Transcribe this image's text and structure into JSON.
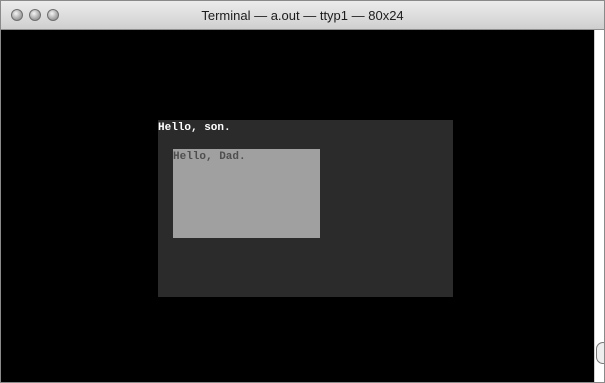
{
  "window": {
    "title": "Terminal — a.out — ttyp1 — 80x24"
  },
  "terminal": {
    "outer_window": {
      "text": "Hello, son."
    },
    "inner_window": {
      "text": "Hello, Dad."
    }
  },
  "colors": {
    "terminal_bg": "#000000",
    "outer_window_bg": "#2b2b2b",
    "inner_window_bg": "#a0a0a0",
    "outer_text": "#ffffff",
    "inner_text": "#4f4f4f"
  }
}
